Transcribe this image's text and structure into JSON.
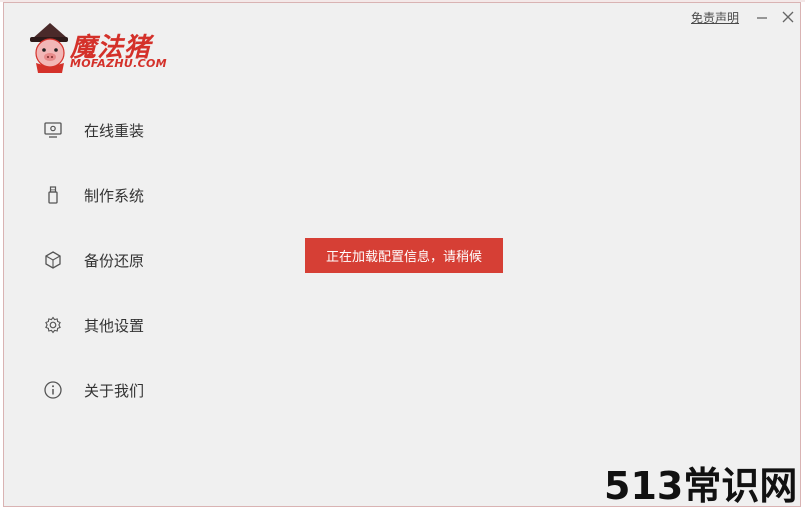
{
  "brand": {
    "name": "魔法猪",
    "domain": "MOFAZHU.COM",
    "accent": "#d4312a"
  },
  "titlebar": {
    "disclaimer": "免责声明",
    "minimize_icon": "minimize-icon",
    "close_icon": "close-icon"
  },
  "sidebar": {
    "items": [
      {
        "label": "在线重装",
        "icon": "monitor-icon"
      },
      {
        "label": "制作系统",
        "icon": "usb-drive-icon"
      },
      {
        "label": "备份还原",
        "icon": "backup-cube-icon"
      },
      {
        "label": "其他设置",
        "icon": "gear-icon"
      },
      {
        "label": "关于我们",
        "icon": "info-icon"
      }
    ]
  },
  "toast": {
    "message": "正在加载配置信息，请稍候",
    "color": "#d63f35"
  },
  "watermark": "513常识网"
}
